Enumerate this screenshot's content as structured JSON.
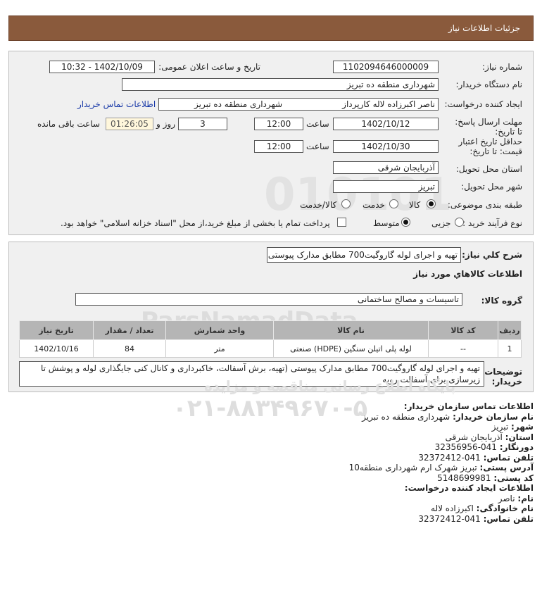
{
  "header": {
    "title": "جزئیات اطلاعات نیاز"
  },
  "fields": {
    "need_number_label": "شماره نیاز:",
    "need_number": "1102094646000009",
    "announce_label": "تاریخ و ساعت اعلان عمومی:",
    "announce_value": "1402/10/09 - 10:32",
    "buyer_org_label": "نام دستگاه خریدار:",
    "buyer_org": "شهرداری منطقه ده تبریز",
    "creator_label": "ایجاد کننده درخواست:",
    "creator_name": "ناصر اکبرزاده لاله کارپرداز",
    "creator_org": "شهرداری منطقه ده تبریز",
    "contact_link": "اطلاعات تماس خریدار",
    "deadline_label": "مهلت ارسال پاسخ: تا تاریخ:",
    "deadline_date": "1402/10/12",
    "time_label": "ساعت",
    "deadline_time": "12:00",
    "days_value": "3",
    "days_label": "روز و",
    "remaining_time": "01:26:05",
    "remaining_label": "ساعت باقی مانده",
    "validity_label": "حداقل تاریخ اعتبار قیمت: تا تاریخ:",
    "validity_date": "1402/10/30",
    "validity_time": "12:00",
    "province_label": "استان محل تحویل:",
    "province": "آذربایجان شرقی",
    "city_label": "شهر محل تحویل:",
    "city": "تبریز",
    "category_label": "طبقه بندی موضوعی:",
    "category_options": [
      "کالا",
      "خدمت",
      "کالا/خدمت"
    ],
    "process_label": "نوع فرآیند خرید :",
    "process_options": [
      "جزیی",
      "متوسط"
    ],
    "payment_note": "پرداخت تمام یا بخشی از مبلغ خرید،از محل \"اسناد خزانه اسلامی\" خواهد بود."
  },
  "description": {
    "label": "شرح کلي نياز:",
    "value": "تهیه و اجرای لوله گاروگیت700 مطابق مدارک پیوستی"
  },
  "goods": {
    "section_title": "اطلاعات کالاهاي مورد نياز",
    "group_label": "گروه کالا:",
    "group_value": "تاسیسات و مصالح ساختمانی",
    "columns": [
      "ردیف",
      "کد کالا",
      "نام کالا",
      "واحد شمارش",
      "تعداد / مقدار",
      "تاریخ نیاز"
    ],
    "rows": [
      [
        "1",
        "--",
        "لوله پلی اتیلن سنگین (HDPE) صنعتی",
        "متر",
        "84",
        "1402/10/16"
      ]
    ]
  },
  "buyer_notes": {
    "label": "توضیحات خریدار:",
    "line1": "تهیه و اجرای لوله گاروگیت700 مطابق مدارک پیوستی (تهیه، برش آسفالت، خاکبرداری و کانال کنی جایگذاری لوله و پوشش تا",
    "line2": "زیرسازی برای آسفالت رویه"
  },
  "contact": {
    "title": "اطلاعات تماس سازمان خریدار:",
    "rows": [
      {
        "label": "نام سازمان خریدار:",
        "value": "شهرداری منطقه ده تبریز"
      },
      {
        "label": "شهر:",
        "value": "تبریز"
      },
      {
        "label": "استان:",
        "value": "آذربایجان شرقی"
      },
      {
        "label": "دورنگار:",
        "value": "041-32356956"
      },
      {
        "label": "تلفن تماس:",
        "value": "041-32372412"
      },
      {
        "label": "آدرس پستی:",
        "value": "تبریز شهرک ارم شهرداری منطقه10"
      },
      {
        "label": "کد پستی:",
        "value": "5148699981"
      }
    ],
    "creator_title": "اطلاعات ایجاد کننده درخواست:",
    "creator_rows": [
      {
        "label": "نام:",
        "value": "ناصر"
      },
      {
        "label": "نام خانوادگی:",
        "value": "اکبرزاده لاله"
      },
      {
        "label": "تلفن تماس:",
        "value": "041-32372412"
      }
    ]
  },
  "watermark": {
    "brand": "ParsNamadData",
    "subtitle": "پایگاه اطلاع رسانی مناقصه و مزایده",
    "phone": "۰۲۱-۸۸۳۴۹۶۷۰-۵"
  }
}
